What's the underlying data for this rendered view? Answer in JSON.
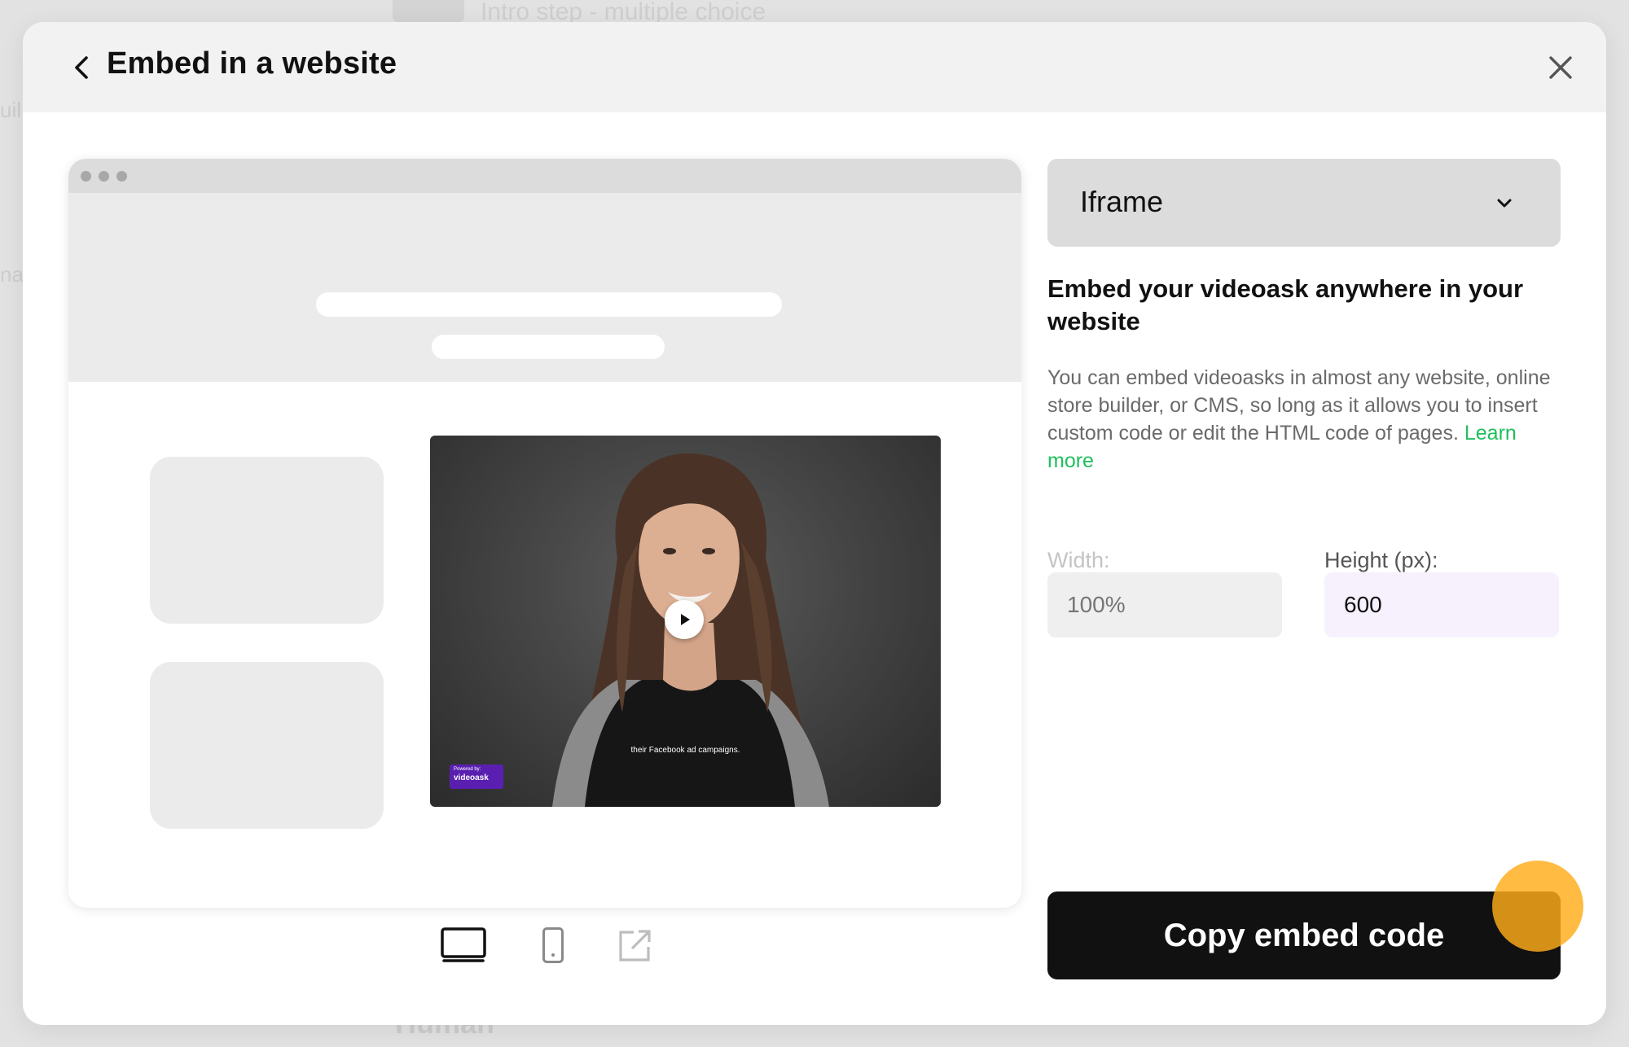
{
  "background": {
    "step_title": "Intro step - multiple choice",
    "left_text_a": "uil",
    "left_text_b": "na",
    "bottom_text": "Human"
  },
  "modal": {
    "title": "Embed in a website",
    "back_icon": "chevron-left-icon",
    "close_icon": "close-icon"
  },
  "preview": {
    "video_caption": "their Facebook ad campaigns.",
    "badge_top": "Powered by:",
    "badge_name": "videoask",
    "devices": [
      "desktop-icon",
      "mobile-icon",
      "external-link-icon"
    ],
    "selected_device": "desktop-icon"
  },
  "panel": {
    "embed_type": "Iframe",
    "heading": "Embed your videoask anywhere in your website",
    "description": "You can embed videoasks in almost any website, online store builder, or CMS, so long as it allows you to insert custom code or edit the HTML code of pages.",
    "learn_more": "Learn more",
    "width_label": "Width:",
    "width_placeholder": "100%",
    "height_label": "Height (px):",
    "height_value": "600",
    "copy_button": "Copy embed code"
  },
  "colors": {
    "accent_green": "#1fbf5c",
    "button_black": "#111111",
    "badge_purple": "#5a1fb0",
    "cursor_highlight": "#ffac18"
  }
}
